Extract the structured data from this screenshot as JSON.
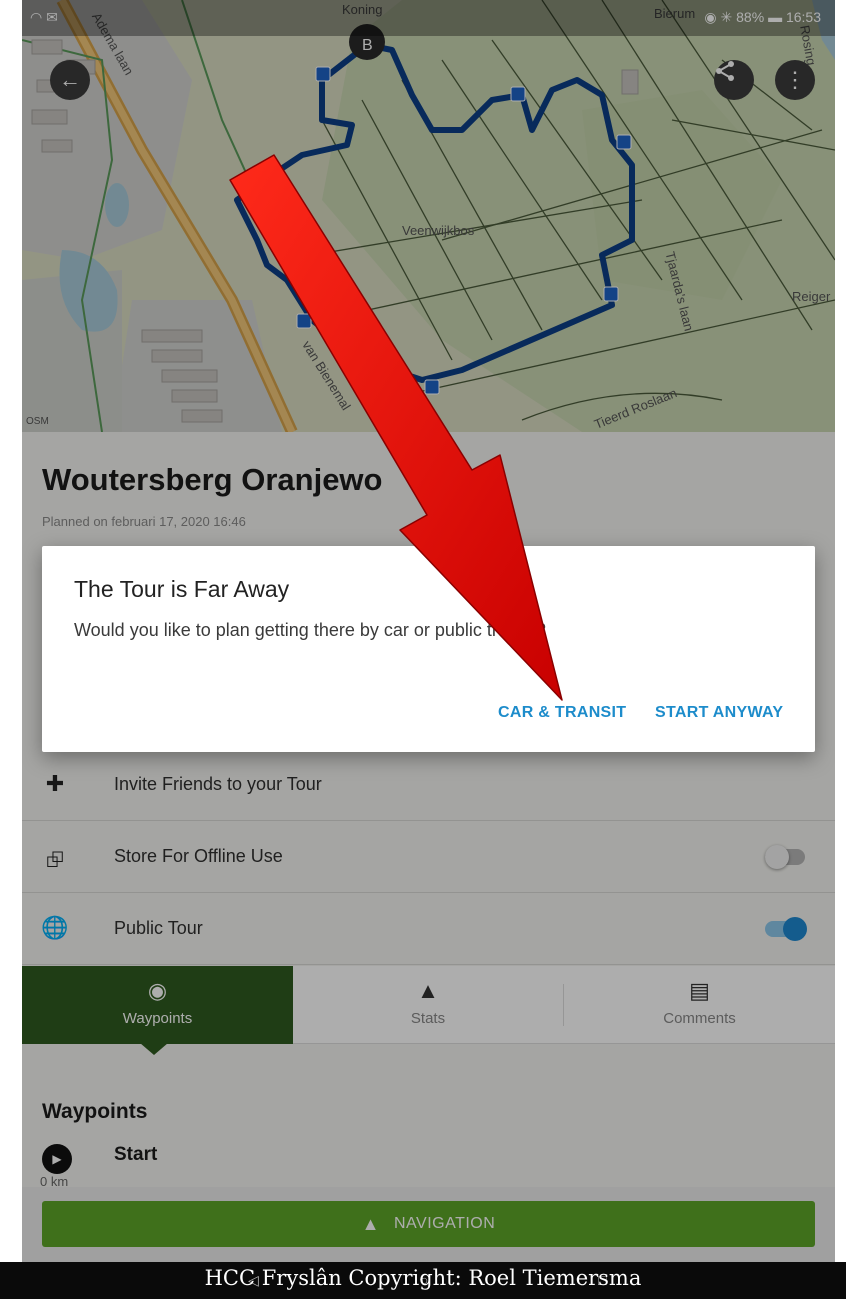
{
  "status_bar": {
    "left_icons": "wifi, message",
    "battery": "88%",
    "time": "16:53"
  },
  "map": {
    "street_labels": [
      "Veenwijkbos",
      "Tjaarda's laan",
      "Reiger",
      "Tieerd Roslaan",
      "van Bienemal",
      "Adema laan",
      "Koning",
      "Bierum",
      "Rosing"
    ],
    "marker_label": "B",
    "attribution": "OSM",
    "back_icon": "arrow-left-icon",
    "share_icon": "share-icon",
    "menu_icon": "more-vertical-icon"
  },
  "tour": {
    "title": "Woutersberg Oranjewo",
    "planned": "Planned on februari 17, 2020 16:46"
  },
  "rows": [
    {
      "icon": "person-add-icon",
      "label": "Invite Friends to your Tour"
    },
    {
      "icon": "pin-icon",
      "label": "Store For Offline Use",
      "toggle": "off"
    },
    {
      "icon": "globe-icon",
      "label": "Public Tour",
      "toggle": "on"
    }
  ],
  "tabs": [
    {
      "icon": "waypoint-icon",
      "label": "Waypoints",
      "active": true
    },
    {
      "icon": "mountain-icon",
      "label": "Stats",
      "active": false
    },
    {
      "icon": "comment-icon",
      "label": "Comments",
      "active": false
    }
  ],
  "waypoints": {
    "title": "Waypoints",
    "start": "Start",
    "distance": "0 km"
  },
  "navigation_button": "NAVIGATION",
  "dialog": {
    "title": "The Tour is Far Away",
    "body": "Would you like to plan getting there by car or public transit?",
    "btn_car": "CAR & TRANSIT",
    "btn_start": "START ANYWAY"
  },
  "caption": "HCC Fryslân Copyright: Roel Tiemersma",
  "colors": {
    "accent_blue": "#1d8ccb",
    "tab_green": "#2f5a1f",
    "nav_green": "#5ea528",
    "route_blue": "#0d3e86",
    "annotation_red": "#e00000"
  }
}
